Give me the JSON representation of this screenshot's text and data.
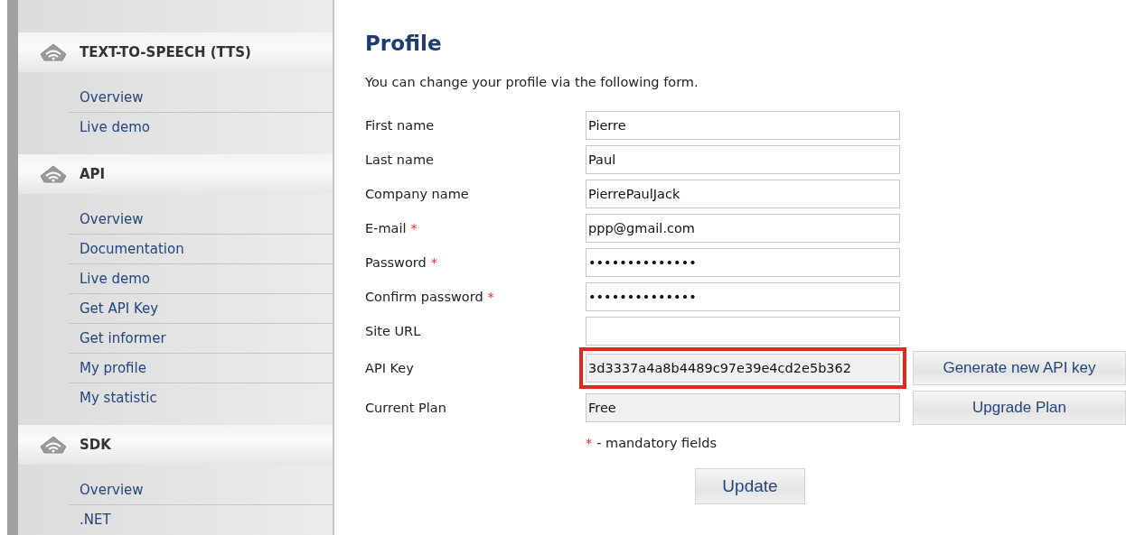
{
  "sidebar": {
    "sections": [
      {
        "title": "TEXT-TO-SPEECH (TTS)",
        "items": [
          {
            "label": "Overview",
            "selected": false
          },
          {
            "label": "Live demo",
            "selected": false
          }
        ]
      },
      {
        "title": "API",
        "items": [
          {
            "label": "Overview",
            "selected": false
          },
          {
            "label": "Documentation",
            "selected": false
          },
          {
            "label": "Live demo",
            "selected": false
          },
          {
            "label": "Get API Key",
            "selected": false
          },
          {
            "label": "Get informer",
            "selected": false
          },
          {
            "label": "My profile",
            "selected": false
          },
          {
            "label": "My statistic",
            "selected": false
          }
        ]
      },
      {
        "title": "SDK",
        "items": [
          {
            "label": "Overview",
            "selected": false
          },
          {
            "label": ".NET",
            "selected": false
          }
        ]
      }
    ]
  },
  "profile": {
    "title": "Profile",
    "intro": "You can change your profile via the following form.",
    "fields": [
      {
        "label": "First name",
        "value": "Pierre",
        "disabled": false
      },
      {
        "label": "Last name",
        "value": "Paul",
        "disabled": false
      },
      {
        "label": "Company name",
        "value": "PierrePaulJack",
        "disabled": false
      },
      {
        "label": "E-mail",
        "mark": "*",
        "value": "ppp@gmail.com",
        "disabled": false
      },
      {
        "label": "Password",
        "mark": "*",
        "value": "••••••••••••••",
        "disabled": false
      },
      {
        "label": "Confirm password",
        "mark": "*",
        "value": "••••••••••••••",
        "disabled": false
      },
      {
        "label": "Site URL",
        "disabled": false
      },
      {
        "label": "API Key",
        "value": "3d3337a4a8b4489c97e39e4cd2e5b362",
        "disabled": true,
        "highlighted": true,
        "button": "Generate new API key"
      },
      {
        "label": "Current Plan",
        "value": "Free",
        "disabled": true,
        "button": "Upgrade Plan"
      }
    ],
    "note": {
      "mark": "*",
      "text": "- mandatory fields"
    },
    "submit": "Update"
  }
}
